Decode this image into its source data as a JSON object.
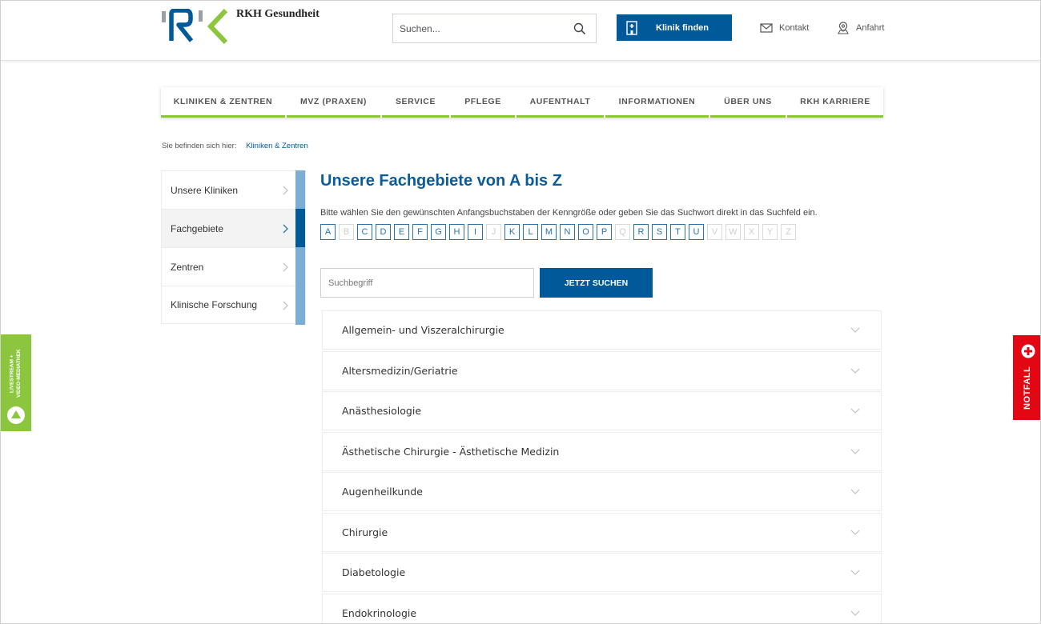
{
  "header": {
    "brand": "RKH Gesundheit",
    "search_placeholder": "Suchen...",
    "klinik_button": "Klinik finden",
    "kontakt": "Kontakt",
    "anfahrt": "Anfahrt"
  },
  "nav": {
    "items": [
      "KLINIKEN & ZENTREN",
      "MVZ (PRAXEN)",
      "SERVICE",
      "PFLEGE",
      "AUFENTHALT",
      "INFORMATIONEN",
      "ÜBER UNS",
      "RKH KARRIERE"
    ]
  },
  "breadcrumb": {
    "label": "Sie befinden sich hier:",
    "link": "Kliniken & Zentren"
  },
  "sidebar": {
    "items": [
      {
        "label": "Unsere Kliniken",
        "active": false
      },
      {
        "label": "Fachgebiete",
        "active": true
      },
      {
        "label": "Zentren",
        "active": false
      },
      {
        "label": "Klinische Forschung",
        "active": false
      }
    ]
  },
  "main": {
    "title": "Unsere Fachgebiete von A bis Z",
    "intro": "Bitte wählen Sie den gewünschten Anfangsbuchstaben der Kenngröße oder geben Sie das Suchwort direkt in das Suchfeld ein.",
    "letters": [
      {
        "l": "A",
        "enabled": true
      },
      {
        "l": "B",
        "enabled": false
      },
      {
        "l": "C",
        "enabled": true
      },
      {
        "l": "D",
        "enabled": true
      },
      {
        "l": "E",
        "enabled": true
      },
      {
        "l": "F",
        "enabled": true
      },
      {
        "l": "G",
        "enabled": true
      },
      {
        "l": "H",
        "enabled": true
      },
      {
        "l": "I",
        "enabled": true
      },
      {
        "l": "J",
        "enabled": false
      },
      {
        "l": "K",
        "enabled": true
      },
      {
        "l": "L",
        "enabled": true
      },
      {
        "l": "M",
        "enabled": true
      },
      {
        "l": "N",
        "enabled": true
      },
      {
        "l": "O",
        "enabled": true
      },
      {
        "l": "P",
        "enabled": true
      },
      {
        "l": "Q",
        "enabled": false
      },
      {
        "l": "R",
        "enabled": true
      },
      {
        "l": "S",
        "enabled": true
      },
      {
        "l": "T",
        "enabled": true
      },
      {
        "l": "U",
        "enabled": true
      },
      {
        "l": "V",
        "enabled": false
      },
      {
        "l": "W",
        "enabled": false
      },
      {
        "l": "X",
        "enabled": false
      },
      {
        "l": "Y",
        "enabled": false
      },
      {
        "l": "Z",
        "enabled": false
      }
    ],
    "search_placeholder": "Suchbegriff",
    "search_button": "JETZT SUCHEN",
    "specialties": [
      "Allgemein- und Viszeralchirurgie",
      "Altersmedizin/Geriatrie",
      "Anästhesiologie",
      "Ästhetische Chirurgie - Ästhetische Medizin",
      "Augenheilkunde",
      "Chirurgie",
      "Diabetologie",
      "Endokrinologie"
    ]
  },
  "side_tabs": {
    "livestream_line1": "LIVESTREAM +",
    "livestream_line2": "VIDEO-MEDIATHEK",
    "notfall": "NOTFALL"
  },
  "colors": {
    "primary_blue": "#005a9a",
    "light_blue": "#7aaed6",
    "green": "#8cc63f",
    "red": "#e30613"
  },
  "icons": {
    "search": "search-icon",
    "hospital": "hospital-icon",
    "mail": "mail-icon",
    "map_pin": "map-pin-icon",
    "chevron_right": "chevron-right-icon",
    "chevron_down": "chevron-down-icon",
    "play": "play-icon",
    "plus": "plus-circle-icon"
  }
}
